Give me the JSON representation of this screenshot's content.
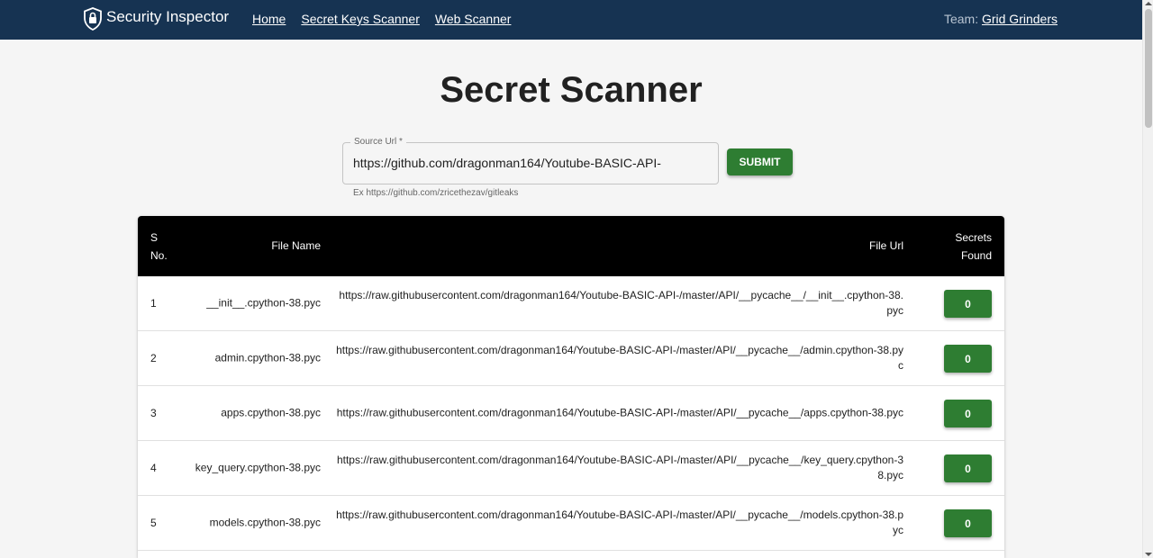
{
  "navbar": {
    "brand": "Security Inspector",
    "links": [
      "Home",
      "Secret Keys Scanner",
      "Web Scanner"
    ],
    "team_label": "Team:",
    "team_name": "Grid Grinders"
  },
  "page": {
    "title": "Secret Scanner"
  },
  "form": {
    "label": "Source Url *",
    "value": "https://github.com/dragonman164/Youtube-BASIC-API-",
    "helper": "Ex https://github.com/zricethezav/gitleaks",
    "submit": "SUBMIT"
  },
  "table": {
    "headers": {
      "sno_line1": "S",
      "sno_line2": "No.",
      "file": "File Name",
      "url": "File Url",
      "secrets_line1": "Secrets",
      "secrets_line2": "Found"
    },
    "rows": [
      {
        "sno": "1",
        "file": "__init__.cpython-38.pyc",
        "url": "https://raw.githubusercontent.com/dragonman164/Youtube-BASIC-API-/master/API/__pycache__/__init__.cpython-38.pyc",
        "secrets": "0"
      },
      {
        "sno": "2",
        "file": "admin.cpython-38.pyc",
        "url": "https://raw.githubusercontent.com/dragonman164/Youtube-BASIC-API-/master/API/__pycache__/admin.cpython-38.pyc",
        "secrets": "0"
      },
      {
        "sno": "3",
        "file": "apps.cpython-38.pyc",
        "url": "https://raw.githubusercontent.com/dragonman164/Youtube-BASIC-API-/master/API/__pycache__/apps.cpython-38.pyc",
        "secrets": "0"
      },
      {
        "sno": "4",
        "file": "key_query.cpython-38.pyc",
        "url": "https://raw.githubusercontent.com/dragonman164/Youtube-BASIC-API-/master/API/__pycache__/key_query.cpython-38.pyc",
        "secrets": "0"
      },
      {
        "sno": "5",
        "file": "models.cpython-38.pyc",
        "url": "https://raw.githubusercontent.com/dragonman164/Youtube-BASIC-API-/master/API/__pycache__/models.cpython-38.pyc",
        "secrets": "0"
      }
    ]
  },
  "icons": {
    "logo": "shield-lock-icon"
  },
  "colors": {
    "navbar": "#163352",
    "accent": "#2e7d32",
    "table_header": "#000000"
  }
}
